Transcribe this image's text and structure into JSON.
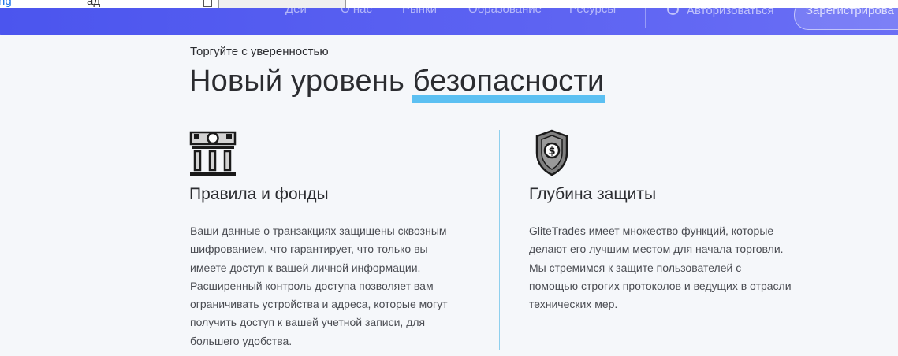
{
  "browser": {
    "fragment_left": "ng",
    "fragment_mid": "ад"
  },
  "header": {
    "nav": [
      "Деи",
      "О нас",
      "Рынки",
      "Образование",
      "Ресурсы"
    ],
    "login": "Авторизоваться",
    "register": "Зарегистрирова",
    "accent_color": "#4b55ee"
  },
  "hero": {
    "eyebrow": "Торгуйте с уверенностью",
    "title_prefix": "Новый уровень ",
    "title_highlight": "безопасности",
    "highlight_color": "#5cc0f2"
  },
  "features": [
    {
      "icon": "bank-building-icon",
      "title": "Правила и фонды",
      "lines": [
        "Ваши данные о транзакциях защищены сквозным",
        "шифрованием, что гарантирует, что только вы",
        "имеете доступ к вашей личной информации.",
        "Расширенный контроль доступа позволяет вам",
        "ограничивать устройства и адреса, которые могут",
        "получить доступ к вашей учетной записи, для",
        "большего удобства."
      ]
    },
    {
      "icon": "shield-dollar-icon",
      "title": "Глубина защиты",
      "lines": [
        "GliteTrades имеет множество функций, которые",
        "делают его лучшим местом для начала торговли.",
        "Мы стремимся к защите пользователей с",
        "помощью строгих протоколов и ведущих в отрасли",
        "технических мер."
      ]
    }
  ]
}
